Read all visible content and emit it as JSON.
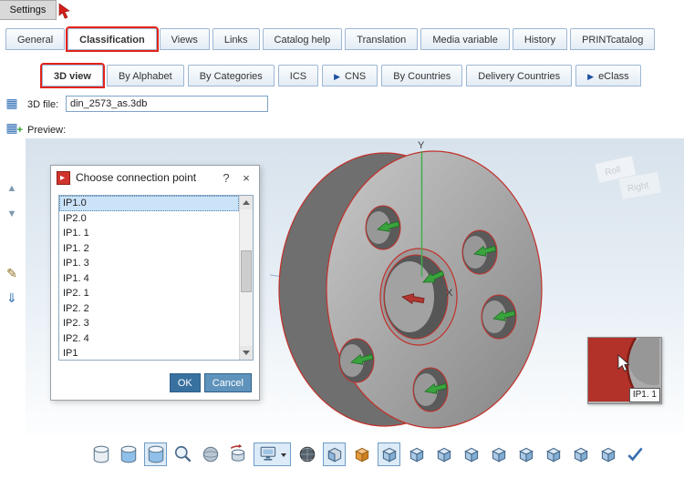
{
  "window": {
    "tab_label": "Settings"
  },
  "tabs_row1": [
    "General",
    "Classification",
    "Views",
    "Links",
    "Catalog help",
    "Translation",
    "Media variable",
    "History",
    "PRINTcatalog"
  ],
  "tabs_row2": [
    "3D view",
    "By Alphabet",
    "By Categories",
    "ICS",
    "CNS",
    "By Countries",
    "Delivery Countries",
    "eClass"
  ],
  "icons": {
    "tab_arrow": "▶"
  },
  "form": {
    "file_label": "3D file:",
    "file_value": "din_2573_as.3db",
    "preview_label": "Preview:"
  },
  "scene": {
    "axis_x_label": "X",
    "axis_y_label": "Y",
    "viewcube_labels": [
      "Roll",
      "Right"
    ],
    "magnifier_label": "IP1. 1"
  },
  "dialog": {
    "title": "Choose connection point",
    "help_label": "?",
    "close_label": "×",
    "items": [
      "IP1.0",
      "IP2.0",
      "IP1. 1",
      "IP1. 2",
      "IP1. 3",
      "IP1. 4",
      "IP2. 1",
      "IP2. 2",
      "IP2. 3",
      "IP2. 4",
      "IP1"
    ],
    "ok_label": "OK",
    "cancel_label": "Cancel"
  },
  "left_toolbar_icons": [
    "catalog-table-icon",
    "catalog-table-add-icon",
    "move-up-icon",
    "move-down-icon",
    "edit-document-icon",
    "import-document-icon"
  ],
  "bottom_toolbar_icons": [
    "cylinder-solid-icon",
    "cylinder-shaded-icon",
    "cylinder-active-icon",
    "zoom-icon",
    "sphere-icon",
    "cylinder-rotate-icon",
    "render-mode-dropdown",
    "mesh-sphere-icon",
    "clip-box-icon",
    "material-box-icon",
    "cube-view-icon-1",
    "cube-view-icon-2",
    "cube-view-icon-3",
    "cube-view-icon-4",
    "cube-view-icon-5",
    "cube-view-icon-6",
    "cube-view-icon-7",
    "cube-view-icon-8",
    "cube-view-icon-9",
    "apply-check-icon"
  ],
  "colors": {
    "annotation_red": "#e2231a",
    "selection_blue": "#cbe3f8",
    "accent_blue": "#3c77a8"
  }
}
